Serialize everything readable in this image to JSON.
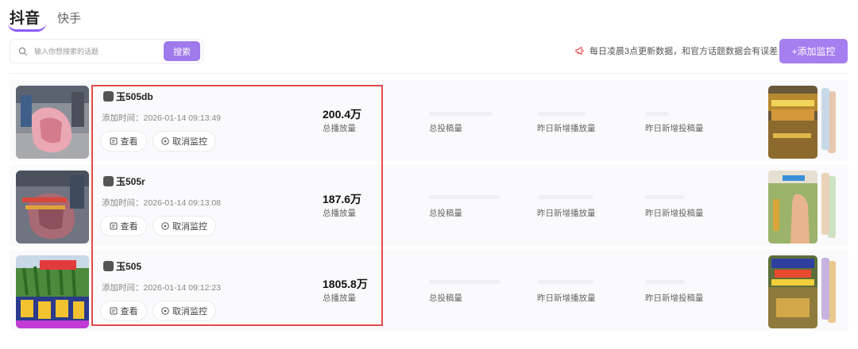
{
  "tabs": [
    {
      "label": "抖音",
      "active": true
    },
    {
      "label": "快手",
      "active": false
    }
  ],
  "search": {
    "placeholder": "输入你想搜索的话题",
    "button_label": "搜索"
  },
  "notice": {
    "text": "每日凌晨3点更新数据，和官方话题数据会有误差"
  },
  "add_button": {
    "label": "+添加监控"
  },
  "rows": [
    {
      "title": "玉505db",
      "added_time": "添加时间：2026-01-14 09:13:49",
      "total_play": "200.4万",
      "total_play_label": "总播放量",
      "posts_label": "总投稿量",
      "new_play_label": "昨日新增播放量",
      "new_posts_label": "昨日新增投稿量",
      "view_label": "查看",
      "cancel_label": "取消监控"
    },
    {
      "title": "玉505r",
      "added_time": "添加时间：2026-01-14 09:13:08",
      "total_play": "187.6万",
      "total_play_label": "总播放量",
      "posts_label": "总投稿量",
      "new_play_label": "昨日新增播放量",
      "new_posts_label": "昨日新增投稿量",
      "view_label": "查看",
      "cancel_label": "取消监控"
    },
    {
      "title": "玉505",
      "added_time": "添加时间：2026-01-14 09:12:23",
      "total_play": "1805.8万",
      "total_play_label": "总播放量",
      "posts_label": "总投稿量",
      "new_play_label": "昨日新增播放量",
      "new_posts_label": "昨日新增投稿量",
      "view_label": "查看",
      "cancel_label": "取消监控"
    }
  ],
  "colors": {
    "accent": "#9f7aea",
    "highlight": "#e24a4a",
    "notice_icon": "#e5484d"
  },
  "icons": {
    "search": "search-icon",
    "notice": "megaphone-icon",
    "view": "doc-icon",
    "cancel": "close-circle-icon"
  }
}
